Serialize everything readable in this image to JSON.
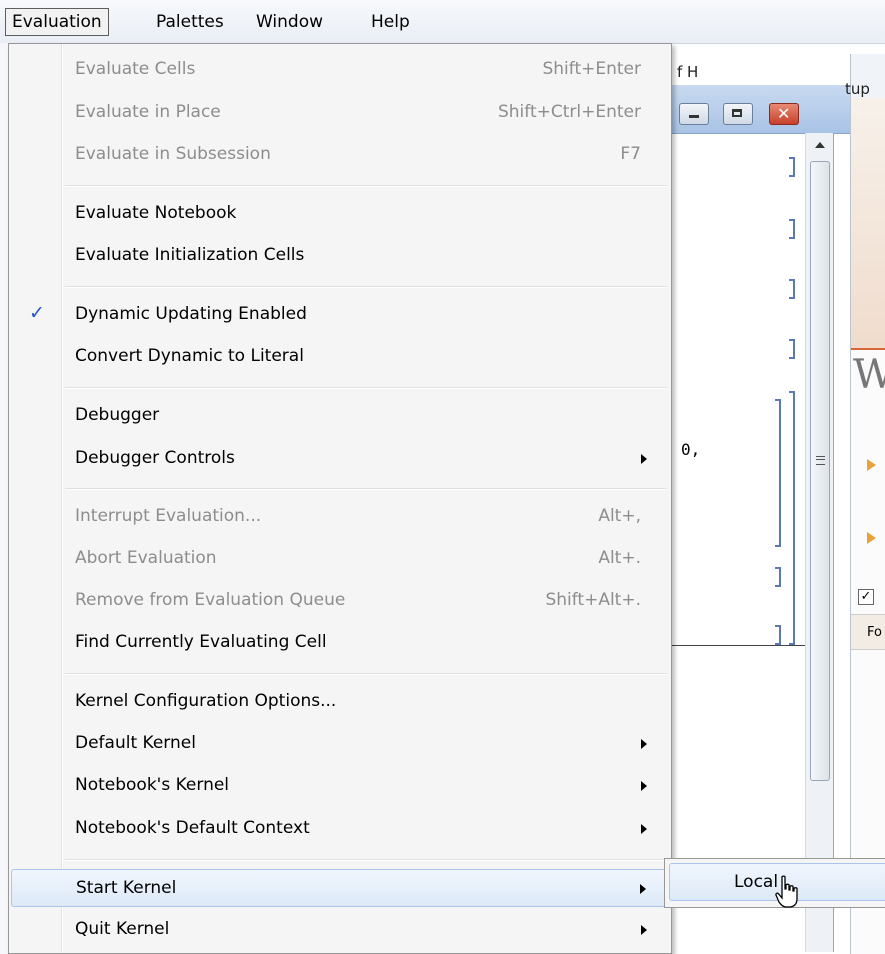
{
  "menubar": {
    "items": [
      {
        "label": "Evaluation",
        "active": true
      },
      {
        "label": "Palettes",
        "active": false
      },
      {
        "label": "Window",
        "active": false
      },
      {
        "label": "Help",
        "active": false
      }
    ]
  },
  "evaluation_menu": {
    "groups": [
      [
        {
          "label": "Evaluate Cells",
          "shortcut": "Shift+Enter",
          "enabled": false
        },
        {
          "label": "Evaluate in Place",
          "shortcut": "Shift+Ctrl+Enter",
          "enabled": false
        },
        {
          "label": "Evaluate in Subsession",
          "shortcut": "F7",
          "enabled": false
        }
      ],
      [
        {
          "label": "Evaluate Notebook",
          "enabled": true
        },
        {
          "label": "Evaluate Initialization Cells",
          "enabled": true
        }
      ],
      [
        {
          "label": "Dynamic Updating Enabled",
          "enabled": true,
          "checked": true
        },
        {
          "label": "Convert Dynamic to Literal",
          "enabled": true
        }
      ],
      [
        {
          "label": "Debugger",
          "enabled": true
        },
        {
          "label": "Debugger Controls",
          "enabled": true,
          "submenu": true
        }
      ],
      [
        {
          "label": "Interrupt Evaluation...",
          "shortcut": "Alt+,",
          "enabled": false
        },
        {
          "label": "Abort Evaluation",
          "shortcut": "Alt+.",
          "enabled": false
        },
        {
          "label": "Remove from Evaluation Queue",
          "shortcut": "Shift+Alt+.",
          "enabled": false
        },
        {
          "label": "Find Currently Evaluating Cell",
          "enabled": true
        }
      ],
      [
        {
          "label": "Kernel Configuration Options...",
          "enabled": true
        },
        {
          "label": "Default Kernel",
          "enabled": true,
          "submenu": true
        },
        {
          "label": "Notebook's Kernel",
          "enabled": true,
          "submenu": true
        },
        {
          "label": "Notebook's Default Context",
          "enabled": true,
          "submenu": true
        }
      ],
      [
        {
          "label": "Start Kernel",
          "enabled": true,
          "submenu": true,
          "highlighted": true
        },
        {
          "label": "Quit Kernel",
          "enabled": true,
          "submenu": true
        }
      ]
    ]
  },
  "start_kernel_submenu": {
    "items": [
      {
        "label": "Local",
        "highlighted": true
      }
    ]
  },
  "background_notebook": {
    "title_fragment": "f H",
    "code_fragment": "0,"
  },
  "startup_panel": {
    "tab_label": "tup",
    "heading_fragment": "W",
    "footer_fragment": "Fo"
  },
  "colors": {
    "menu_highlight": "#dde9f8",
    "check_mark": "#2354c8",
    "accent_orange": "#d9653b",
    "disabled_text": "#8d8d8d"
  }
}
